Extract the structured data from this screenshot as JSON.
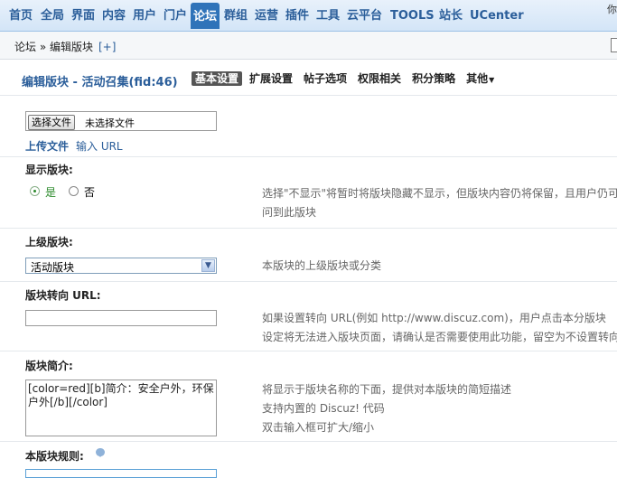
{
  "nav": {
    "items": [
      "首页",
      "全局",
      "界面",
      "内容",
      "用户",
      "门户",
      "论坛",
      "群组",
      "运营",
      "插件",
      "工具",
      "云平台",
      "TOOLS",
      "站长",
      "UCenter"
    ],
    "active_index": 6,
    "corner_text": "你"
  },
  "breadcrumb": {
    "path": "论坛 » 编辑版块",
    "add": "[+]"
  },
  "header": {
    "title": "编辑版块 - 活动召集(fid:46)",
    "tabs": [
      "基本设置",
      "扩展设置",
      "帖子选项",
      "权限相关",
      "积分策略",
      "其他"
    ],
    "active_tab": 0
  },
  "file_upload": {
    "button_label": "选择文件",
    "status": "未选择文件",
    "upload_link": "上传文件",
    "url_link": "输入 URL"
  },
  "show_forum": {
    "label": "显示版块:",
    "options": [
      "是",
      "否"
    ],
    "selected": "是",
    "desc_line1": "选择\"不显示\"将暂时将版块隐藏不显示，但版块内容仍将保留，且用户仍可",
    "desc_line2": "问到此版块"
  },
  "parent_forum": {
    "label": "上级版块:",
    "selected": "活动版块",
    "desc": "本版块的上级版块或分类"
  },
  "redirect_url": {
    "label": "版块转向 URL:",
    "value": "",
    "desc_line1": "如果设置转向 URL(例如 http://www.discuz.com)，用户点击本分版块",
    "desc_line2": "设定将无法进入版块页面，请确认是否需要使用此功能，留空为不设置转向"
  },
  "description": {
    "label": "版块简介:",
    "value": "[color=red][b]简介：安全户外，环保户外[/b][/color]",
    "desc_line1": "将显示于版块名称的下面，提供对本版块的简短描述",
    "desc_line2": "支持内置的 Discuz! 代码",
    "desc_line3": "双击输入框可扩大/缩小"
  },
  "rules": {
    "label": "本版块规则:"
  },
  "colors": {
    "nav_active": "#2f73b9",
    "link": "#2b5e9a",
    "tab_active": "#555555"
  }
}
